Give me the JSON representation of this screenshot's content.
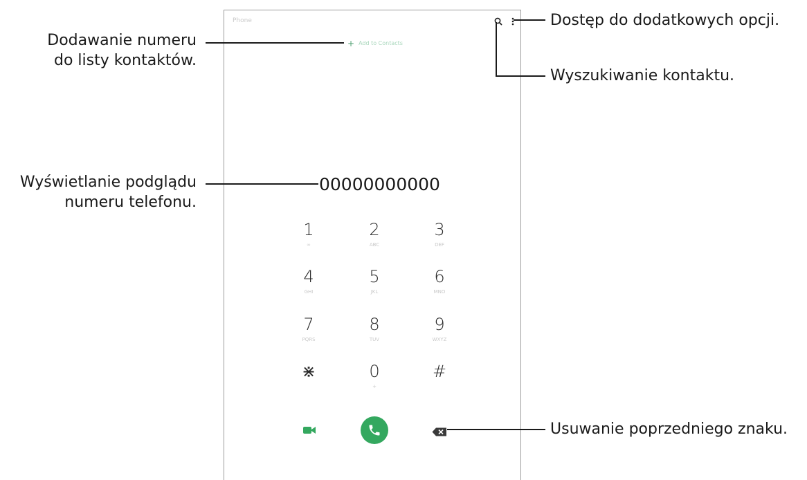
{
  "phone": {
    "app_title": "Phone",
    "add_contact": {
      "plus": "+",
      "label": "Add to Contacts"
    },
    "number": "00000000000",
    "icons": {
      "search": "search-icon",
      "more": "more-options-icon",
      "video": "video-call-icon",
      "call": "phone-call-icon",
      "backspace": "backspace-icon"
    },
    "colors": {
      "accent": "#34a85f",
      "add_label": "#a9d7bc"
    },
    "keypad": [
      {
        "digit": "1",
        "sub": "∞"
      },
      {
        "digit": "2",
        "sub": "ABC"
      },
      {
        "digit": "3",
        "sub": "DEF"
      },
      {
        "digit": "4",
        "sub": "GHI"
      },
      {
        "digit": "5",
        "sub": "JKL"
      },
      {
        "digit": "6",
        "sub": "MNO"
      },
      {
        "digit": "7",
        "sub": "PQRS"
      },
      {
        "digit": "8",
        "sub": "TUV"
      },
      {
        "digit": "9",
        "sub": "WXYZ"
      },
      {
        "digit": "⋇",
        "sub": ""
      },
      {
        "digit": "0",
        "sub": "+"
      },
      {
        "digit": "#",
        "sub": ""
      }
    ]
  },
  "callouts": {
    "add_number": {
      "line1": "Dodawanie numeru",
      "line2": "do listy kontaktów."
    },
    "preview": {
      "line1": "Wyświetlanie podglądu",
      "line2": "numeru telefonu."
    },
    "more_options": "Dostęp do dodatkowych opcji.",
    "search": "Wyszukiwanie kontaktu.",
    "delete": "Usuwanie poprzedniego znaku."
  }
}
